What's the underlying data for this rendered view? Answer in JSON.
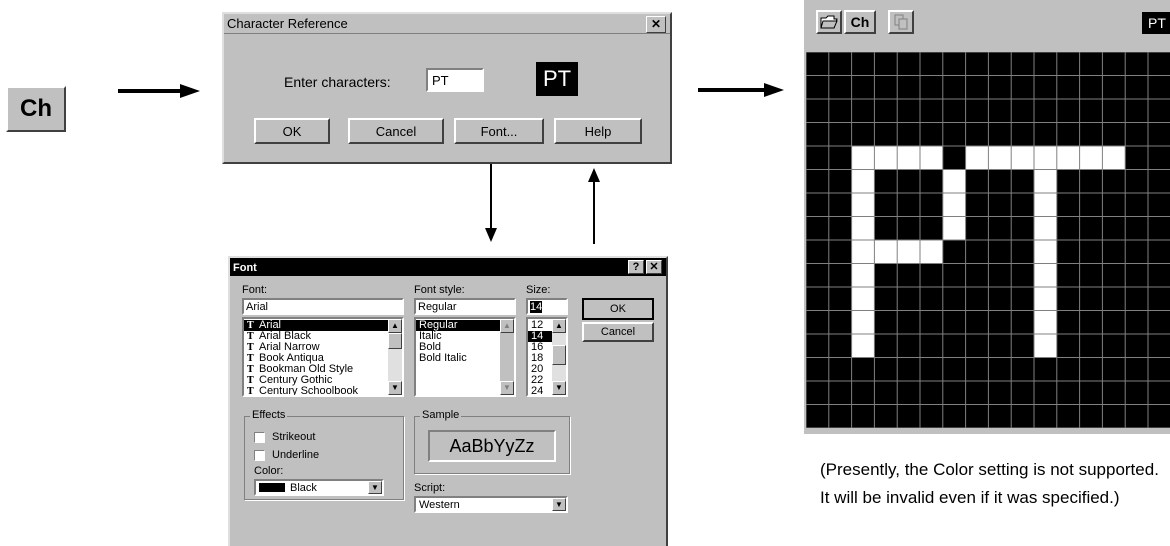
{
  "toolbar_button_ch": "Ch",
  "char_ref": {
    "title": "Character Reference",
    "close": "✕",
    "prompt": "Enter characters:",
    "input_value": "PT",
    "preview": "PT",
    "buttons": {
      "ok": "OK",
      "cancel": "Cancel",
      "font": "Font...",
      "help": "Help"
    }
  },
  "font_dialog": {
    "title": "Font",
    "help_btn": "?",
    "close_btn": "✕",
    "font_label": "Font:",
    "font_value": "Arial",
    "fonts": [
      "Arial",
      "Arial Black",
      "Arial Narrow",
      "Book Antiqua",
      "Bookman Old Style",
      "Century Gothic",
      "Century Schoolbook"
    ],
    "style_label": "Font style:",
    "style_value": "Regular",
    "styles": [
      "Regular",
      "Italic",
      "Bold",
      "Bold Italic"
    ],
    "size_label": "Size:",
    "size_value": "14",
    "sizes": [
      "12",
      "14",
      "16",
      "18",
      "20",
      "22",
      "24"
    ],
    "ok": "OK",
    "cancel": "Cancel",
    "effects_label": "Effects",
    "strikeout": "Strikeout",
    "underline": "Underline",
    "color_label": "Color:",
    "color_value": "Black",
    "sample_label": "Sample",
    "sample_text": "AaBbYyZz",
    "script_label": "Script:",
    "script_value": "Western"
  },
  "editor": {
    "toolbar_ch": "Ch",
    "preview": "PT",
    "grid_cols": 16,
    "grid_rows": 16,
    "lit_cells": [
      [
        4,
        2
      ],
      [
        4,
        3
      ],
      [
        4,
        4
      ],
      [
        4,
        5
      ],
      [
        4,
        7
      ],
      [
        4,
        8
      ],
      [
        4,
        9
      ],
      [
        4,
        10
      ],
      [
        4,
        11
      ],
      [
        4,
        12
      ],
      [
        4,
        13
      ],
      [
        5,
        2
      ],
      [
        5,
        6
      ],
      [
        5,
        10
      ],
      [
        6,
        2
      ],
      [
        6,
        6
      ],
      [
        6,
        10
      ],
      [
        7,
        2
      ],
      [
        7,
        6
      ],
      [
        7,
        10
      ],
      [
        8,
        2
      ],
      [
        8,
        3
      ],
      [
        8,
        4
      ],
      [
        8,
        5
      ],
      [
        8,
        10
      ],
      [
        9,
        2
      ],
      [
        9,
        10
      ],
      [
        10,
        2
      ],
      [
        10,
        10
      ],
      [
        11,
        2
      ],
      [
        11,
        10
      ],
      [
        12,
        2
      ],
      [
        12,
        10
      ]
    ]
  },
  "note": "(Presently, the Color setting is not supported. It will be invalid even if it was specified.)"
}
